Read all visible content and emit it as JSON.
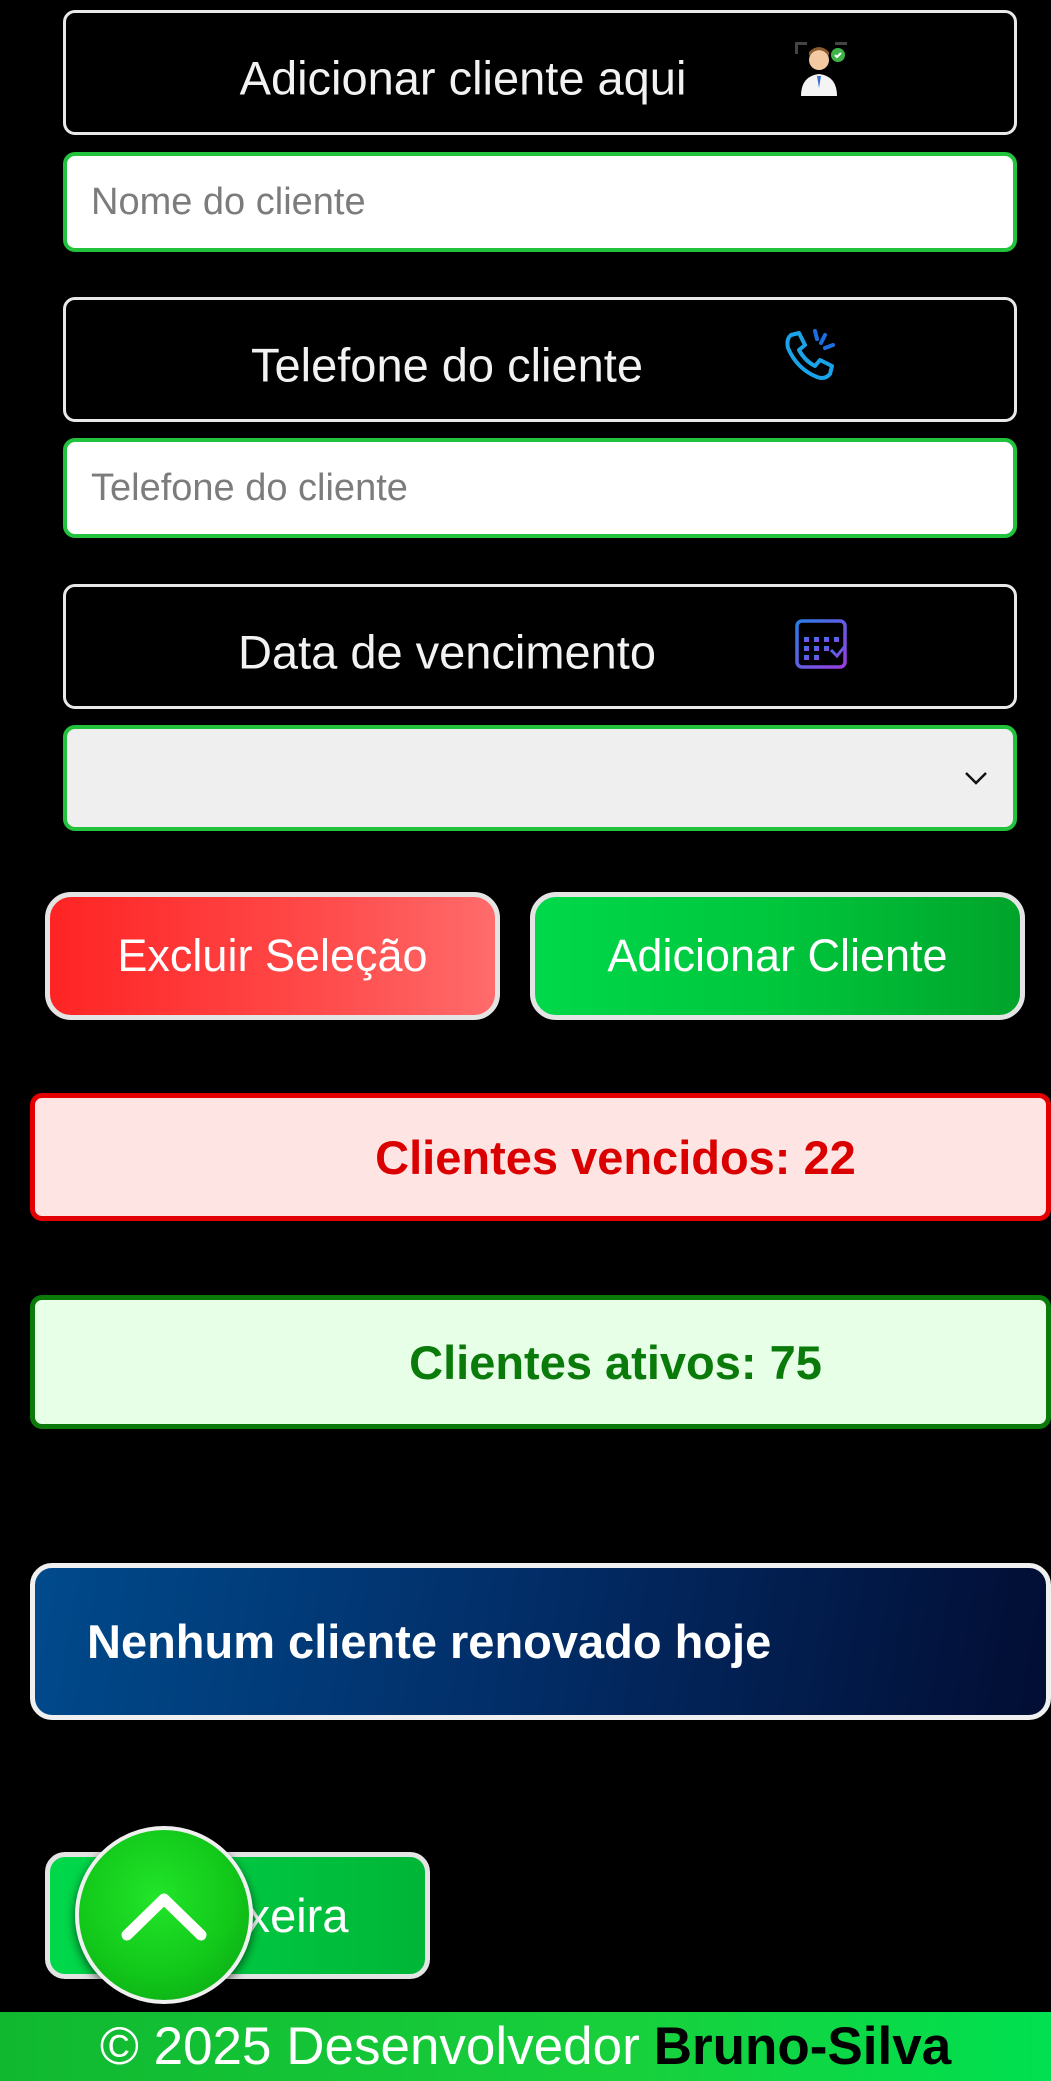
{
  "form": {
    "client_section": {
      "label": "Adicionar cliente aqui",
      "icon": "client-avatar-icon"
    },
    "name_input": {
      "placeholder": "Nome do cliente",
      "value": ""
    },
    "phone_section": {
      "label": "Telefone do cliente",
      "icon": "phone-call-icon"
    },
    "phone_input": {
      "placeholder": "Telefone do cliente",
      "value": ""
    },
    "due_section": {
      "label": "Data de vencimento",
      "icon": "calendar-icon"
    },
    "due_select": {
      "value": ""
    }
  },
  "actions": {
    "delete_label": "Excluir Seleção",
    "add_label": "Adicionar Cliente"
  },
  "stats": {
    "expired": "Clientes vencidos: 22",
    "active": "Clientes ativos: 75"
  },
  "renewed_text": "Nenhum cliente renovado hoje",
  "trash_label": "Lixeira",
  "footer": {
    "text": "© 2025 Desenvolvedor",
    "author": "Bruno-Silva"
  },
  "colors": {
    "field_border": "#22c23c",
    "expired": "#db0000",
    "active": "#0a7a0a",
    "renewed_bg": "#022c66"
  }
}
